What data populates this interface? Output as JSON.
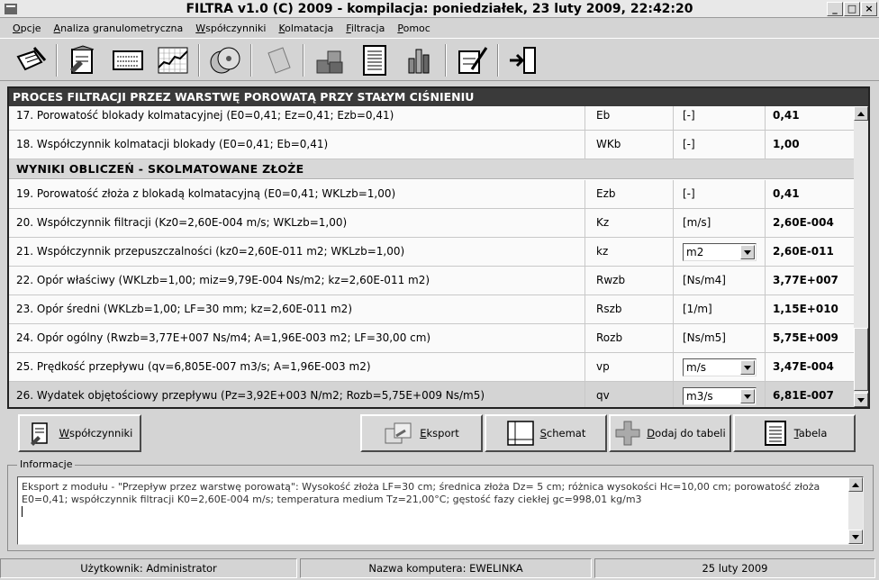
{
  "window": {
    "title": "FILTRA v1.0 (C) 2009 - kompilacja: poniedziałek, 23 luty 2009, 22:42:20"
  },
  "menu": [
    "Opcje",
    "Analiza granulometryczna",
    "Współczynniki",
    "Kolmatacja",
    "Filtracja",
    "Pomoc"
  ],
  "toolbar": {
    "icons": [
      "notepad-pen-icon",
      "document-edit-icon",
      "list-doc-icon",
      "chart-grid-icon",
      "disks-icon",
      "book-icon",
      "cubes-icon",
      "report-icon",
      "bar-chart-icon",
      "signature-doc-icon",
      "exit-door-icon"
    ]
  },
  "panel": {
    "title": "PROCES FILTRACJI PRZEZ WARSTWĘ POROWATĄ PRZY STAŁYM CIŚNIENIU"
  },
  "rows": [
    {
      "desc": "17. Porowatość blokady kolmatacyjnej (E0=0,41; Ez=0,41; Ezb=0,41)",
      "sym": "Eb",
      "unit": "[-]",
      "val": "0,41"
    },
    {
      "desc": "18. Współczynnik kolmatacji blokady (E0=0,41; Eb=0,41)",
      "sym": "WKb",
      "unit": "[-]",
      "val": "1,00"
    },
    {
      "section": "WYNIKI OBLICZEŃ - SKOLMATOWANE ZŁOŻE"
    },
    {
      "desc": "19. Porowatość złoża z blokadą kolmatacyjną (E0=0,41; WKLzb=1,00)",
      "sym": "Ezb",
      "unit": "[-]",
      "val": "0,41"
    },
    {
      "desc": "20. Współczynnik filtracji (Kz0=2,60E-004 m/s; WKLzb=1,00)",
      "sym": "Kz",
      "unit": "[m/s]",
      "val": "2,60E-004"
    },
    {
      "desc": "21. Współczynnik przepuszczalności (kz0=2,60E-011 m2; WKLzb=1,00)",
      "sym": "kz",
      "unit": "m2",
      "combo": true,
      "val": "2,60E-011"
    },
    {
      "desc": "22. Opór właściwy (WKLzb=1,00; miz=9,79E-004 Ns/m2; kz=2,60E-011 m2)",
      "sym": "Rwzb",
      "unit": "[Ns/m4]",
      "val": "3,77E+007"
    },
    {
      "desc": "23. Opór średni (WKLzb=1,00; LF=30 mm; kz=2,60E-011 m2)",
      "sym": "Rszb",
      "unit": "[1/m]",
      "val": "1,15E+010"
    },
    {
      "desc": "24. Opór ogólny (Rwzb=3,77E+007 Ns/m4; A=1,96E-003 m2; LF=30,00 cm)",
      "sym": "Rozb",
      "unit": "[Ns/m5]",
      "val": "5,75E+009"
    },
    {
      "desc": "25. Prędkość przepływu (qv=6,805E-007 m3/s; A=1,96E-003 m2)",
      "sym": "vp",
      "unit": "m/s",
      "combo": true,
      "val": "3,47E-004"
    },
    {
      "desc": "26. Wydatek objętościowy przepływu (Pz=3,92E+003 N/m2; Rozb=5,75E+009 Ns/m5)",
      "sym": "qv",
      "unit": "m3/s",
      "combo": true,
      "val": "6,81E-007",
      "selected": true
    }
  ],
  "buttons": {
    "wspolczynniki": "Współczynniki",
    "eksport": "Eksport",
    "schemat": "Schemat",
    "dodaj": "Dodaj do tabeli",
    "tabela": "Tabela"
  },
  "info": {
    "legend": "Informacje",
    "text": "Eksport z modułu - \"Przepływ przez warstwę porowatą\": Wysokość złoża LF=30 cm; średnica złoża Dz= 5 cm; różnica wysokości Hc=10,00 cm; porowatość złoża E0=0,41; współczynnik filtracji K0=2,60E-004 m/s; temperatura medium Tz=21,00°C; gęstość fazy ciekłej gc=998,01 kg/m3"
  },
  "status": {
    "user": "Użytkownik: Administrator",
    "computer": "Nazwa komputera: EWELINKA",
    "date": "25 luty 2009"
  }
}
